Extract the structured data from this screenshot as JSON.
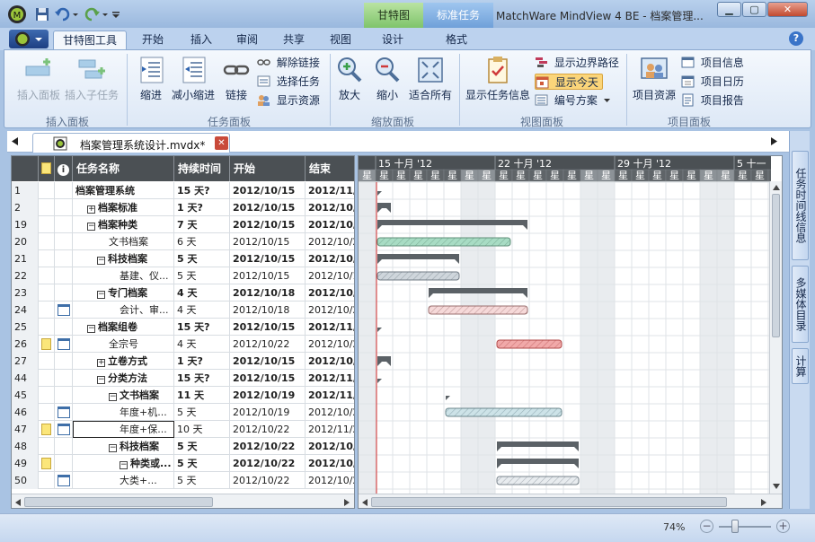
{
  "titlebar": {
    "context_tabs": [
      "甘特图",
      "标准任务"
    ],
    "window_title": "MatchWare MindView 4 BE - 档案管理..."
  },
  "ribbon_tabs": [
    "甘特图工具",
    "开始",
    "插入",
    "审阅",
    "共享",
    "视图",
    "设计",
    "格式"
  ],
  "ribbon": {
    "insert_panel": {
      "label": "插入面板",
      "insert_panel_btn": "插入面板",
      "insert_subtask_btn": "插入子任务"
    },
    "task_panel": {
      "label": "任务面板",
      "indent": "缩进",
      "outdent": "减小缩进",
      "link": "链接",
      "unlink": "解除链接",
      "select_task": "选择任务",
      "show_resource": "显示资源"
    },
    "zoom_panel": {
      "label": "缩放面板",
      "zoom_in": "放大",
      "zoom_out": "缩小",
      "fit_all": "适合所有"
    },
    "view_panel": {
      "label": "视图面板",
      "show_task_info": "显示任务信息",
      "show_critical_path": "显示边界路径",
      "show_today": "显示今天",
      "numbering": "编号方案"
    },
    "project_panel": {
      "label": "项目面板",
      "project_resource": "项目资源",
      "project_info": "项目信息",
      "project_calendar": "项目日历",
      "project_report": "项目报告"
    }
  },
  "document_tab": "档案管理系统设计.mvdx*",
  "table": {
    "headers": [
      "任务名称",
      "持续时间",
      "开始",
      "结束"
    ],
    "rows": [
      {
        "id": "1",
        "name": "档案管理系统",
        "toggle": "",
        "dur": "15 天?",
        "start": "2012/10/15",
        "end": "2012/11/2",
        "bold": true,
        "level": 0,
        "note": false,
        "cal": false
      },
      {
        "id": "2",
        "name": "档案标准",
        "toggle": "⊞",
        "dur": "1 天?",
        "start": "2012/10/15",
        "end": "2012/10/1",
        "bold": true,
        "level": 1,
        "note": false,
        "cal": false
      },
      {
        "id": "19",
        "name": "档案种类",
        "toggle": "⊟",
        "dur": "7 天",
        "start": "2012/10/15",
        "end": "2012/10/2",
        "bold": true,
        "level": 1,
        "note": false,
        "cal": false
      },
      {
        "id": "20",
        "name": "文书档案",
        "toggle": "",
        "dur": "6 天",
        "start": "2012/10/15",
        "end": "2012/10/2",
        "bold": false,
        "level": 3,
        "note": false,
        "cal": false
      },
      {
        "id": "21",
        "name": "科技档案",
        "toggle": "⊟",
        "dur": "5 天",
        "start": "2012/10/15",
        "end": "2012/10/1",
        "bold": true,
        "level": 2,
        "note": false,
        "cal": false
      },
      {
        "id": "22",
        "name": "基建、仪...",
        "toggle": "",
        "dur": "5 天",
        "start": "2012/10/15",
        "end": "2012/10/1",
        "bold": false,
        "level": 4,
        "note": false,
        "cal": false
      },
      {
        "id": "23",
        "name": "专门档案",
        "toggle": "⊟",
        "dur": "4 天",
        "start": "2012/10/18",
        "end": "2012/10/2",
        "bold": true,
        "level": 2,
        "note": false,
        "cal": false
      },
      {
        "id": "24",
        "name": "会计、审...",
        "toggle": "",
        "dur": "4 天",
        "start": "2012/10/18",
        "end": "2012/10/2",
        "bold": false,
        "level": 4,
        "note": false,
        "cal": true
      },
      {
        "id": "25",
        "name": "档案组卷",
        "toggle": "⊟",
        "dur": "15 天?",
        "start": "2012/10/15",
        "end": "2012/11/2",
        "bold": true,
        "level": 1,
        "note": false,
        "cal": false
      },
      {
        "id": "26",
        "name": "全宗号",
        "toggle": "",
        "dur": "4 天",
        "start": "2012/10/22",
        "end": "2012/10/2",
        "bold": false,
        "level": 3,
        "note": true,
        "cal": true
      },
      {
        "id": "27",
        "name": "立卷方式",
        "toggle": "⊞",
        "dur": "1 天?",
        "start": "2012/10/15",
        "end": "2012/10/1",
        "bold": true,
        "level": 2,
        "note": false,
        "cal": false
      },
      {
        "id": "44",
        "name": "分类方法",
        "toggle": "⊟",
        "dur": "15 天?",
        "start": "2012/10/15",
        "end": "2012/11/2",
        "bold": true,
        "level": 2,
        "note": false,
        "cal": false
      },
      {
        "id": "45",
        "name": "文书档案",
        "toggle": "⊟",
        "dur": "11 天",
        "start": "2012/10/19",
        "end": "2012/11/2",
        "bold": true,
        "level": 3,
        "note": false,
        "cal": false
      },
      {
        "id": "46",
        "name": "年度+机...",
        "toggle": "",
        "dur": "5 天",
        "start": "2012/10/19",
        "end": "2012/10/2",
        "bold": false,
        "level": 4,
        "note": false,
        "cal": true
      },
      {
        "id": "47",
        "name": "年度+保...",
        "toggle": "",
        "dur": "10 天",
        "start": "2012/10/22",
        "end": "2012/11/2",
        "bold": false,
        "level": 4,
        "note": true,
        "cal": true,
        "selected": true
      },
      {
        "id": "48",
        "name": "科技档案",
        "toggle": "⊟",
        "dur": "5 天",
        "start": "2012/10/22",
        "end": "2012/10/2",
        "bold": true,
        "level": 3,
        "note": false,
        "cal": false
      },
      {
        "id": "49",
        "name": "种类或...",
        "toggle": "⊟",
        "dur": "5 天",
        "start": "2012/10/22",
        "end": "2012/10/2",
        "bold": true,
        "level": 4,
        "note": true,
        "cal": false
      },
      {
        "id": "50",
        "name": "大类+...",
        "toggle": "",
        "dur": "5 天",
        "start": "2012/10/22",
        "end": "2012/10/2",
        "bold": false,
        "level": 4,
        "note": false,
        "cal": true
      }
    ]
  },
  "gantt": {
    "weeks": [
      "15 十月 '12",
      "22 十月 '12",
      "29 十月 '12",
      "5 十一"
    ],
    "day_label": "星",
    "timeline_start": "2012/10/14",
    "today": "2012/10/15",
    "bars": [
      {
        "start": "2012/10/15",
        "end": "2012/11/2",
        "kind": "summary"
      },
      {
        "start": "2012/10/15",
        "end": "2012/10/15",
        "kind": "summary"
      },
      {
        "start": "2012/10/15",
        "end": "2012/10/23",
        "kind": "summary"
      },
      {
        "start": "2012/10/15",
        "end": "2012/10/22",
        "kind": "task",
        "fill": "#a8dcc4",
        "stroke": "#5f8f7a"
      },
      {
        "start": "2012/10/15",
        "end": "2012/10/19",
        "kind": "summary"
      },
      {
        "start": "2012/10/15",
        "end": "2012/10/19",
        "kind": "task",
        "fill": "#cfd6dc",
        "stroke": "#707b84"
      },
      {
        "start": "2012/10/18",
        "end": "2012/10/23",
        "kind": "summary"
      },
      {
        "start": "2012/10/18",
        "end": "2012/10/23",
        "kind": "task",
        "fill": "#f6d9d9",
        "stroke": "#9a6f6f"
      },
      {
        "start": "2012/10/15",
        "end": "2012/11/2",
        "kind": "summary"
      },
      {
        "start": "2012/10/22",
        "end": "2012/10/25",
        "kind": "task",
        "fill": "#f1a9a9",
        "stroke": "#b04a4a"
      },
      {
        "start": "2012/10/15",
        "end": "2012/10/15",
        "kind": "summary"
      },
      {
        "start": "2012/10/15",
        "end": "2012/11/2",
        "kind": "summary"
      },
      {
        "start": "2012/10/19",
        "end": "2012/11/2",
        "kind": "summary"
      },
      {
        "start": "2012/10/19",
        "end": "2012/10/25",
        "kind": "task",
        "fill": "#cde3e8",
        "stroke": "#6b878d"
      },
      {
        "start": "2012/10/22",
        "end": "2012/11/2",
        "kind": "task",
        "fill": "#e0c8e0",
        "stroke": "#8a5f8a"
      },
      {
        "start": "2012/10/22",
        "end": "2012/10/26",
        "kind": "summary"
      },
      {
        "start": "2012/10/22",
        "end": "2012/10/26",
        "kind": "summary"
      },
      {
        "start": "2012/10/22",
        "end": "2012/10/26",
        "kind": "task",
        "fill": "#e8ecef",
        "stroke": "#7a858e"
      }
    ]
  },
  "side_panel": [
    "任务时间线信息",
    "多媒体目录",
    "计算"
  ],
  "status": {
    "zoom": "74%"
  }
}
